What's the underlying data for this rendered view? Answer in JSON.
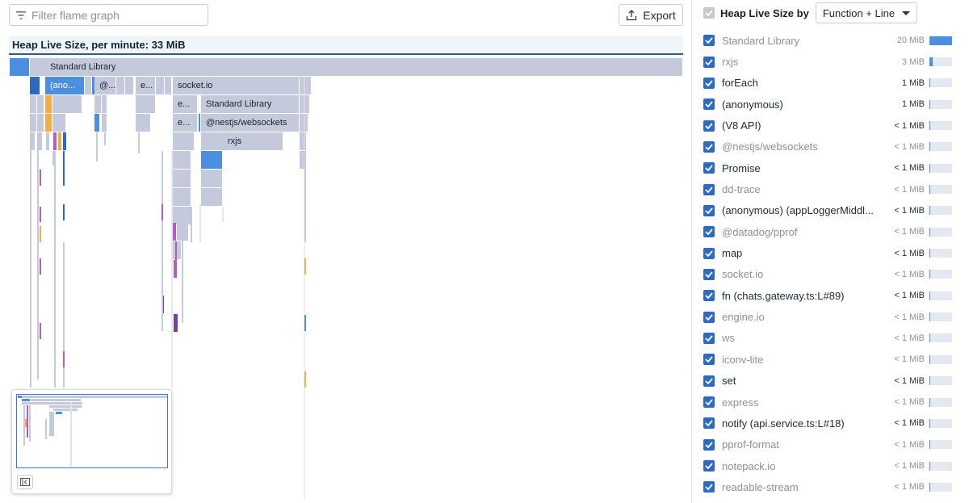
{
  "filter": {
    "placeholder": "Filter flame graph",
    "value": ""
  },
  "export_label": "Export",
  "flame_header": "Heap Live Size, per minute: 33 MiB",
  "frame_labels": {
    "root": "Standard Library",
    "anon": "(ano...",
    "nest_ellipsis": "@...",
    "e1": "e...",
    "e2": "e...",
    "e3": "e...",
    "socketio": "socket.io",
    "stdlib2": "Standard Library",
    "nestws": "@nestjs/websockets",
    "rxjs": "rxjs"
  },
  "colors": {
    "selected_frame": "#4a8fe0",
    "frame_default": "#c5c9dc",
    "purple": "#b65cc0",
    "dark_purple": "#7a3fa1",
    "orange": "#f2ad45",
    "accent": "#2d6ac2"
  },
  "legend": {
    "title": "Heap Live Size by",
    "group_by": "Function + Line",
    "items": [
      {
        "name": "Standard Library",
        "value": "20 MiB",
        "share": 1.0,
        "dim": true
      },
      {
        "name": "rxjs",
        "value": "3 MiB",
        "share": 0.15,
        "dim": true
      },
      {
        "name": "forEach",
        "value": "1 MiB",
        "share": 0.05,
        "dim": false
      },
      {
        "name": "(anonymous)",
        "value": "1 MiB",
        "share": 0.05,
        "dim": false
      },
      {
        "name": "(V8 API)",
        "value": "< 1 MiB",
        "share": 0.04,
        "dim": false
      },
      {
        "name": "@nestjs/websockets",
        "value": "< 1 MiB",
        "share": 0.04,
        "dim": true
      },
      {
        "name": "Promise",
        "value": "< 1 MiB",
        "share": 0.04,
        "dim": false
      },
      {
        "name": "dd-trace",
        "value": "< 1 MiB",
        "share": 0.03,
        "dim": true
      },
      {
        "name": "(anonymous) (appLoggerMiddl...",
        "value": "< 1 MiB",
        "share": 0.03,
        "dim": false
      },
      {
        "name": "@datadog/pprof",
        "value": "< 1 MiB",
        "share": 0.03,
        "dim": true
      },
      {
        "name": "map",
        "value": "< 1 MiB",
        "share": 0.03,
        "dim": false
      },
      {
        "name": "socket.io",
        "value": "< 1 MiB",
        "share": 0.02,
        "dim": true
      },
      {
        "name": "fn (chats.gateway.ts:L#89)",
        "value": "< 1 MiB",
        "share": 0.02,
        "dim": false
      },
      {
        "name": "engine.io",
        "value": "< 1 MiB",
        "share": 0.02,
        "dim": true
      },
      {
        "name": "ws",
        "value": "< 1 MiB",
        "share": 0.02,
        "dim": true
      },
      {
        "name": "iconv-lite",
        "value": "< 1 MiB",
        "share": 0.02,
        "dim": true
      },
      {
        "name": "set",
        "value": "< 1 MiB",
        "share": 0.02,
        "dim": false
      },
      {
        "name": "express",
        "value": "< 1 MiB",
        "share": 0.01,
        "dim": true
      },
      {
        "name": "notify (api.service.ts:L#18)",
        "value": "< 1 MiB",
        "share": 0.01,
        "dim": false
      },
      {
        "name": "pprof-format",
        "value": "< 1 MiB",
        "share": 0.01,
        "dim": true
      },
      {
        "name": "notepack.io",
        "value": "< 1 MiB",
        "share": 0.01,
        "dim": true
      },
      {
        "name": "readable-stream",
        "value": "< 1 MiB",
        "share": 0.01,
        "dim": true
      }
    ]
  }
}
